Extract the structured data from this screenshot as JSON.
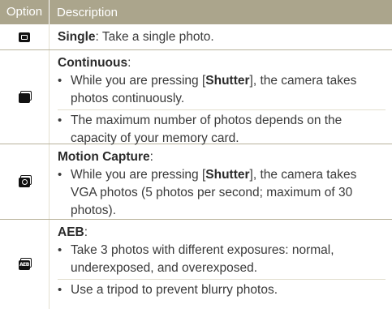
{
  "header": {
    "option": "Option",
    "description": "Description"
  },
  "rows": [
    {
      "icon": "single-shot-icon",
      "name": "Single",
      "text": ": Take a single photo."
    },
    {
      "icon": "continuous-shot-icon",
      "name": "Continuous",
      "suffix": ":",
      "bullets": [
        {
          "pre": "While you are pressing [",
          "key": "Shutter",
          "post": "], the camera takes photos continuously."
        },
        {
          "text": "The maximum number of photos depends on the capacity of your memory card."
        }
      ]
    },
    {
      "icon": "motion-capture-icon",
      "name": "Motion Capture",
      "suffix": ":",
      "bullets": [
        {
          "pre": "While you are pressing [",
          "key": "Shutter",
          "post": "], the camera takes VGA photos (5 photos per second; maximum of 30 photos)."
        }
      ]
    },
    {
      "icon": "aeb-icon",
      "icon_label": "AEB",
      "name": "AEB",
      "suffix": ":",
      "bullets": [
        {
          "text": "Take 3 photos with different exposures: normal, underexposed, and overexposed."
        },
        {
          "text": "Use a tripod to prevent blurry photos."
        }
      ]
    }
  ],
  "bullet_glyph": "•",
  "colors": {
    "header_bg": "#aba58c",
    "row_rule": "#b9b39c"
  }
}
